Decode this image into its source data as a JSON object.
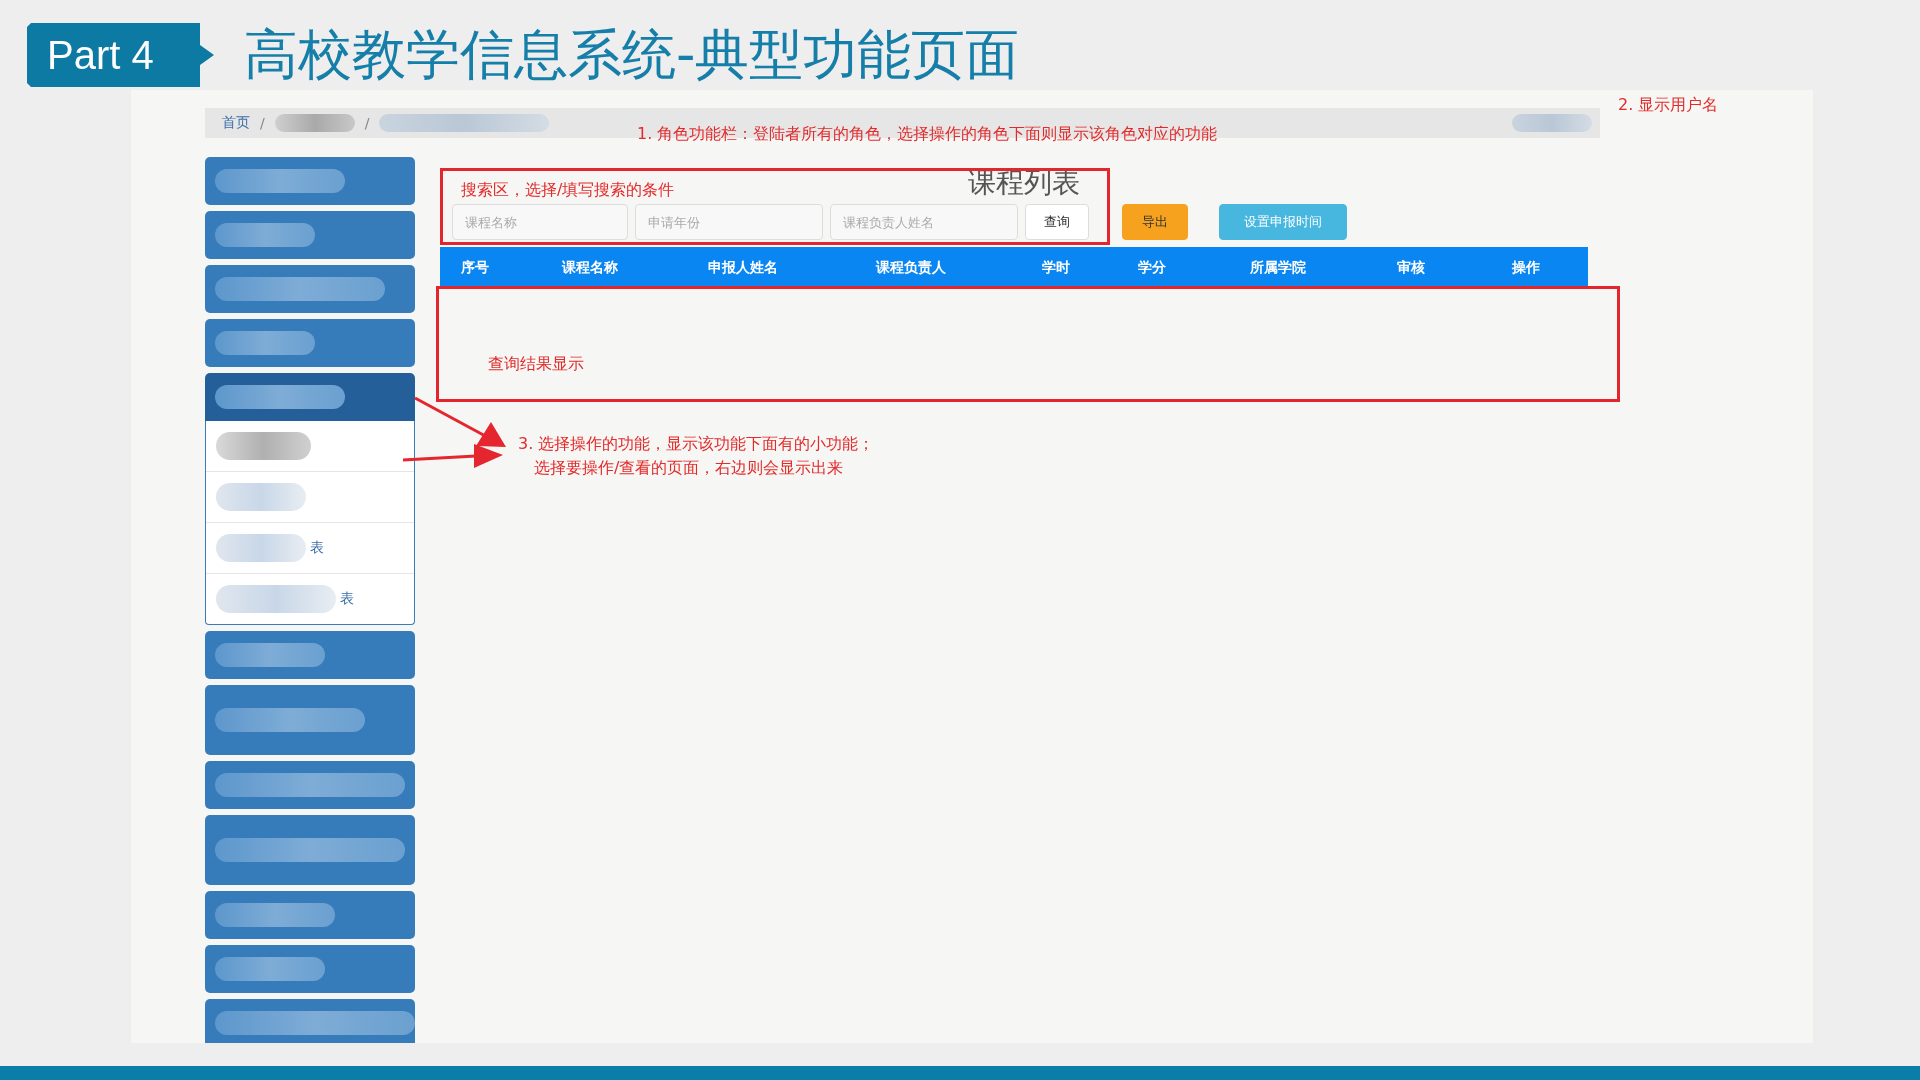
{
  "slide": {
    "badge": "Part 4",
    "title": "高校教学信息系统-典型功能页面"
  },
  "breadcrumb": {
    "items": [
      {
        "kind": "link",
        "text": "首页"
      },
      {
        "kind": "separator",
        "text": "/"
      },
      {
        "kind": "blurred"
      },
      {
        "kind": "separator",
        "text": "/"
      },
      {
        "kind": "blurred"
      }
    ]
  },
  "sidebar": {
    "items": [
      {
        "expanded": false,
        "kind": "short"
      },
      {
        "expanded": false,
        "kind": "short"
      },
      {
        "expanded": false,
        "kind": "short"
      },
      {
        "expanded": false,
        "kind": "short"
      },
      {
        "expanded": true,
        "kind": "short",
        "children": [
          {
            "kind": "blurred"
          },
          {
            "kind": "blurred"
          },
          {
            "kind": "partial",
            "text": "表"
          },
          {
            "kind": "partial",
            "text": "表"
          }
        ]
      },
      {
        "expanded": false,
        "kind": "short"
      },
      {
        "expanded": false,
        "kind": "tall"
      },
      {
        "expanded": false,
        "kind": "short"
      },
      {
        "expanded": false,
        "kind": "tall"
      },
      {
        "expanded": false,
        "kind": "short"
      },
      {
        "expanded": false,
        "kind": "short"
      },
      {
        "expanded": false,
        "kind": "short"
      }
    ]
  },
  "page": {
    "title": "课程列表",
    "search_fields": [
      {
        "placeholder": "课程名称"
      },
      {
        "placeholder": "申请年份"
      },
      {
        "placeholder": "课程负责人姓名"
      }
    ],
    "buttons": [
      {
        "label": "查询",
        "kind": "default"
      },
      {
        "label": "导出",
        "kind": "warning"
      },
      {
        "label": "设置申报时间",
        "kind": "info"
      }
    ],
    "table": {
      "columns": [
        "序号",
        "课程名称",
        "申报人姓名",
        "课程负责人",
        "学时",
        "学分",
        "所属学院",
        "审核",
        "操作"
      ]
    }
  },
  "annotations": [
    {
      "kind": "note",
      "lines": [
        "1. 角色功能栏：登陆者所有的角色，选择操作的角色下面则显示该角色对应的功能"
      ]
    },
    {
      "kind": "note",
      "lines": [
        "2. 显示用户名"
      ]
    },
    {
      "kind": "box",
      "lines": [
        "搜索区，选择/填写搜索的条件"
      ]
    },
    {
      "kind": "box",
      "lines": [
        "查询结果显示"
      ]
    },
    {
      "kind": "arrow",
      "lines": [
        "3. 选择操作的功能，显示该功能下面有的小功能；",
        "选择要操作/查看的页面，右边则会显示出来"
      ]
    }
  ]
}
